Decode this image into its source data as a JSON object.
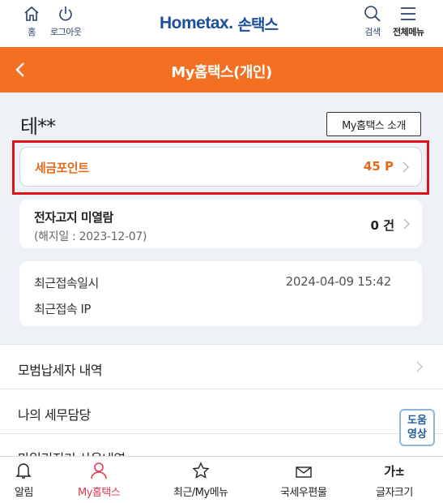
{
  "topbar": {
    "home_label": "홈",
    "logout_label": "로그아웃",
    "logo_text": "Hometax.",
    "logo_sub": "손택스",
    "search_label": "검색",
    "menu_label": "전체메뉴"
  },
  "header": {
    "title": "My홈택스(개인)"
  },
  "profile": {
    "user_name": "테**",
    "intro_button": "My홈택스 소개"
  },
  "cards": {
    "tax_point_label": "세금포인트",
    "tax_point_value": "45 P",
    "bill_label": "전자고지 미열람",
    "bill_sub": "(해지일 : 2023-12-07)",
    "bill_value": "0 건",
    "last_access_label": "최근접속일시",
    "last_access_value": "2024-04-09  15:42",
    "last_ip_label": "최근접속 IP"
  },
  "list": {
    "items": [
      {
        "label": "모범납세자 내역"
      },
      {
        "label": "나의 세무담당"
      },
      {
        "label": "마일리지기 사용내역"
      }
    ]
  },
  "help": {
    "line1": "도움",
    "line2": "영상"
  },
  "bottom_nav": {
    "alarm": "알림",
    "my": "My홈택스",
    "recent": "최근/My메뉴",
    "post": "국세우편물",
    "font": "글자크기",
    "font_icon": "가±"
  },
  "colors": {
    "accent_orange": "#f36f21",
    "highlight_red": "#e0121c",
    "active_nav": "#e03a52",
    "brand_blue": "#1c4f9c"
  }
}
